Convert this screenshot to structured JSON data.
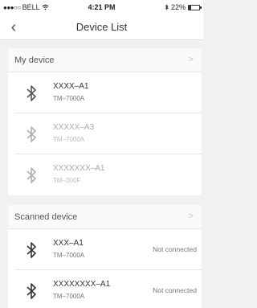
{
  "status_bar": {
    "carrier": "BELL",
    "signal": "●●●○○",
    "time": "4:21 PM",
    "battery": "22%",
    "battery_level": 0.22
  },
  "nav": {
    "back_icon": "chevron-left-icon",
    "title": "Device List"
  },
  "my_device": {
    "title": "My device",
    "chevron": ">",
    "devices": [
      {
        "name": "XXXX–A1",
        "model": "TM–7000A",
        "icon": "bluetooth-icon"
      },
      {
        "name": "XXXXX–A3",
        "model": "TM–7000A",
        "icon": "bluetooth-icon"
      },
      {
        "name": "XXXXXXX–A1",
        "model": "TM–300F",
        "icon": "bluetooth-icon"
      }
    ]
  },
  "scanned_device": {
    "title": "Scanned device",
    "chevron": ">",
    "devices": [
      {
        "name": "XXX–A1",
        "model": "TM–7000A",
        "status": "Not connected",
        "icon": "bluetooth-icon"
      },
      {
        "name": "XXXXXXXX–A1",
        "model": "TM–7000A",
        "status": "Not connected",
        "icon": "bluetooth-icon"
      }
    ]
  },
  "colors": {
    "background": "#f1f1f3",
    "faded_text": "#aaaaaa"
  }
}
